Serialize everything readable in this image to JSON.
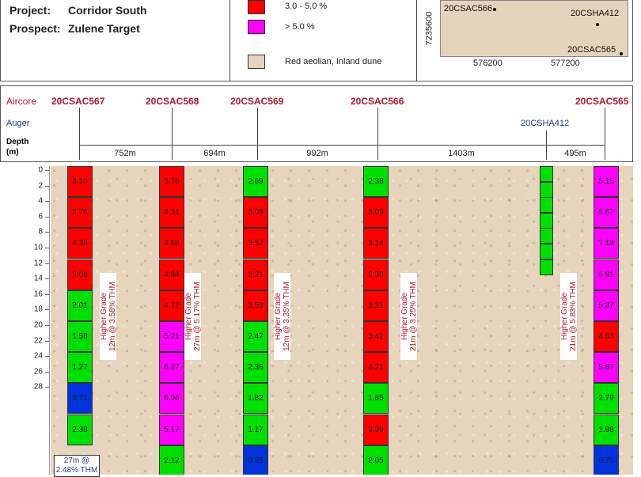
{
  "project": {
    "label": "Project:",
    "value": "Corridor South"
  },
  "prospect": {
    "label": "Prospect:",
    "value": "Zulene Target"
  },
  "legend": [
    {
      "color": "#ff0000",
      "label": "3.0 - 5.0 %"
    },
    {
      "color": "#ff00ff",
      "label": "> 5.0 %"
    },
    {
      "color": "#e6d3bb",
      "label": "Red aeolian, Inland dune"
    }
  ],
  "map": {
    "y_coord": "7235600",
    "x_coords": [
      "576200",
      "577200"
    ],
    "holes": [
      "20CSAC566",
      "20CSHA412",
      "20CSAC565"
    ]
  },
  "section": {
    "aircore_label": "Aircore",
    "auger_label": "Auger",
    "depth_label": "Depth",
    "depth_unit": "(m)",
    "aircore_holes": [
      "20CSAC567",
      "20CSAC568",
      "20CSAC569",
      "20CSAC566",
      "20CSAC565"
    ],
    "auger_holes": [
      "20CSHA412"
    ],
    "distances": [
      "752m",
      "694m",
      "992m",
      "1403m",
      "495m"
    ]
  },
  "depth_ticks": [
    "0",
    "2",
    "4",
    "6",
    "8",
    "10",
    "12",
    "14",
    "16",
    "18",
    "20",
    "22",
    "24",
    "26",
    "28"
  ],
  "colors": {
    "red": "#ff0000",
    "green": "#00e000",
    "magenta": "#ff00ff",
    "blue": "#0033dd"
  },
  "columns": [
    {
      "hole": "20CSAC567",
      "cells": [
        {
          "v": "3.10",
          "c": "red"
        },
        {
          "v": "3.76",
          "c": "red"
        },
        {
          "v": "4.38",
          "c": "red"
        },
        {
          "v": "3.08",
          "c": "red"
        },
        {
          "v": "2.01",
          "c": "green"
        },
        {
          "v": "1.58",
          "c": "green"
        },
        {
          "v": "1.27",
          "c": "green"
        },
        {
          "v": "0.71",
          "c": "blue"
        },
        {
          "v": "2.38",
          "c": "green"
        }
      ],
      "note": [
        "Higher Grade",
        "12m @ 3.58% THM"
      ]
    },
    {
      "hole": "20CSAC568",
      "cells": [
        {
          "v": "3.76",
          "c": "red"
        },
        {
          "v": "4.31",
          "c": "red"
        },
        {
          "v": "4.68",
          "c": "red"
        },
        {
          "v": "4.84",
          "c": "red"
        },
        {
          "v": "4.72",
          "c": "red"
        },
        {
          "v": "5.21",
          "c": "magenta"
        },
        {
          "v": "6.27",
          "c": "magenta"
        },
        {
          "v": "6.96",
          "c": "magenta"
        },
        {
          "v": "5.17",
          "c": "magenta"
        },
        {
          "v": "2.12",
          "c": "green"
        }
      ],
      "note": [
        "Higher Grade",
        "27m @ 5.17% THM"
      ]
    },
    {
      "hole": "20CSAC569",
      "cells": [
        {
          "v": "2.69",
          "c": "green"
        },
        {
          "v": "3.08",
          "c": "red"
        },
        {
          "v": "3.52",
          "c": "red"
        },
        {
          "v": "3.21",
          "c": "red"
        },
        {
          "v": "3.59",
          "c": "red"
        },
        {
          "v": "2.47",
          "c": "green"
        },
        {
          "v": "2.36",
          "c": "green"
        },
        {
          "v": "1.82",
          "c": "green"
        },
        {
          "v": "1.17",
          "c": "green"
        },
        {
          "v": "0.95",
          "c": "blue"
        }
      ],
      "note": [
        "Higher Grade",
        "12m @ 3.35% THM"
      ]
    },
    {
      "hole": "20CSAC566",
      "cells": [
        {
          "v": "2.38",
          "c": "green"
        },
        {
          "v": "3.09",
          "c": "red"
        },
        {
          "v": "3.14",
          "c": "red"
        },
        {
          "v": "3.30",
          "c": "red"
        },
        {
          "v": "3.21",
          "c": "red"
        },
        {
          "v": "3.42",
          "c": "red"
        },
        {
          "v": "4.21",
          "c": "red"
        },
        {
          "v": "1.85",
          "c": "green"
        },
        {
          "v": "3.39",
          "c": "red"
        },
        {
          "v": "2.05",
          "c": "green"
        }
      ],
      "note": [
        "Higher Grade",
        "21m @ 3.25% THM"
      ]
    },
    {
      "hole": "20CSAC565",
      "cells": [
        {
          "v": "5.15",
          "c": "magenta"
        },
        {
          "v": "5.67",
          "c": "magenta"
        },
        {
          "v": "7.18",
          "c": "magenta"
        },
        {
          "v": "6.91",
          "c": "magenta"
        },
        {
          "v": "5.37",
          "c": "magenta"
        },
        {
          "v": "4.63",
          "c": "red"
        },
        {
          "v": "5.87",
          "c": "magenta"
        },
        {
          "v": "2.79",
          "c": "green"
        },
        {
          "v": "1.98",
          "c": "green"
        },
        {
          "v": "0.70",
          "c": "blue"
        }
      ],
      "note": [
        "Higher Grade",
        "21m @ 5.83% THM"
      ]
    }
  ],
  "summary_567": [
    "27m @",
    "2.48% THM"
  ]
}
